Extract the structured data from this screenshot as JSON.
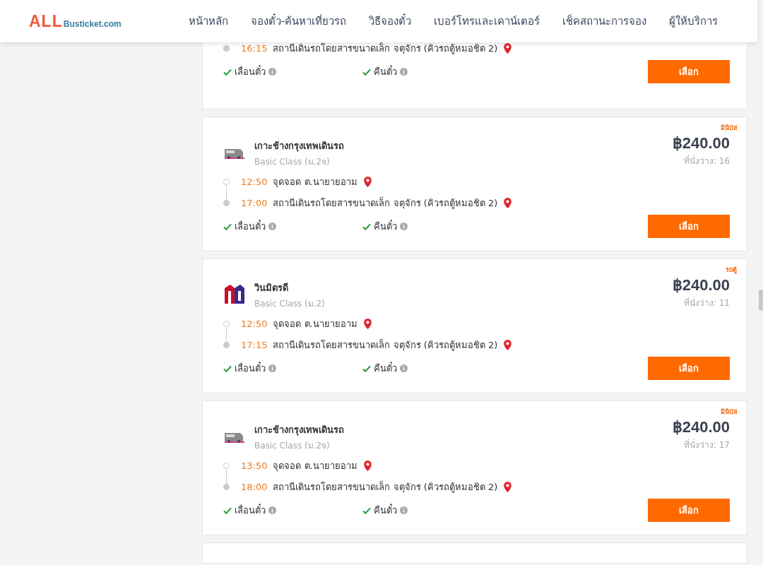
{
  "header": {
    "logo": {
      "brand": "ALL",
      "site": "Busticket.com"
    },
    "nav": [
      {
        "label": "หน้าหลัก"
      },
      {
        "label": "จองตั๋ว-ค้นหาเที่ยวรถ"
      },
      {
        "label": "วิธีจองตั๋ว"
      },
      {
        "label": "เบอร์โทรและเคาน์เตอร์"
      },
      {
        "label": "เช็คสถานะการจอง"
      },
      {
        "label": "ผู้ให้บริการ"
      }
    ]
  },
  "trips": [
    {
      "stops": [
        {
          "time": "16:15",
          "place": "สถานีเดินรถโดยสารขนาดเล็ก จตุจักร (คิวรถตู้หมอชิต 2)",
          "kind": "arrival"
        }
      ],
      "features": [
        {
          "label": "เลื่อนตั๋ว",
          "available": true
        },
        {
          "label": "คืนตั๋ว",
          "available": true
        }
      ],
      "button": "เลือก"
    },
    {
      "tag": "มินิบัส",
      "kind": "bus",
      "operator": "เกาะช้างกรุงเทพเดินรถ",
      "class": "Basic Class (ม.2จ)",
      "price": "฿240.00",
      "seats": "ที่นั่งว่าง: 16",
      "stops": [
        {
          "time": "12:50",
          "place": "จุดจอด ต.นายายอาม",
          "kind": "departure"
        },
        {
          "time": "17:00",
          "place": "สถานีเดินรถโดยสารขนาดเล็ก จตุจักร (คิวรถตู้หมอชิต 2)",
          "kind": "arrival"
        }
      ],
      "features": [
        {
          "label": "เลื่อนตั๋ว",
          "available": true
        },
        {
          "label": "คืนตั๋ว",
          "available": true
        }
      ],
      "button": "เลือก"
    },
    {
      "tag": "รถตู้",
      "kind": "emblem",
      "operator": "วินมิตรดี",
      "class": "Basic Class (ม.2)",
      "price": "฿240.00",
      "seats": "ที่นั่งว่าง: 11",
      "stops": [
        {
          "time": "12:50",
          "place": "จุดจอด ต.นายายอาม",
          "kind": "departure"
        },
        {
          "time": "17:15",
          "place": "สถานีเดินรถโดยสารขนาดเล็ก จตุจักร (คิวรถตู้หมอชิต 2)",
          "kind": "arrival"
        }
      ],
      "features": [
        {
          "label": "เลื่อนตั๋ว",
          "available": true
        },
        {
          "label": "คืนตั๋ว",
          "available": true
        }
      ],
      "button": "เลือก"
    },
    {
      "tag": "มินิบัส",
      "kind": "bus",
      "operator": "เกาะช้างกรุงเทพเดินรถ",
      "class": "Basic Class (ม.2จ)",
      "price": "฿240.00",
      "seats": "ที่นั่งว่าง: 17",
      "stops": [
        {
          "time": "13:50",
          "place": "จุดจอด ต.นายายอาม",
          "kind": "departure"
        },
        {
          "time": "18:00",
          "place": "สถานีเดินรถโดยสารขนาดเล็ก จตุจักร (คิวรถตู้หมอชิต 2)",
          "kind": "arrival"
        }
      ],
      "features": [
        {
          "label": "เลื่อนตั๋ว",
          "available": true
        },
        {
          "label": "คืนตั๋ว",
          "available": true
        }
      ],
      "button": "เลือก"
    }
  ]
}
